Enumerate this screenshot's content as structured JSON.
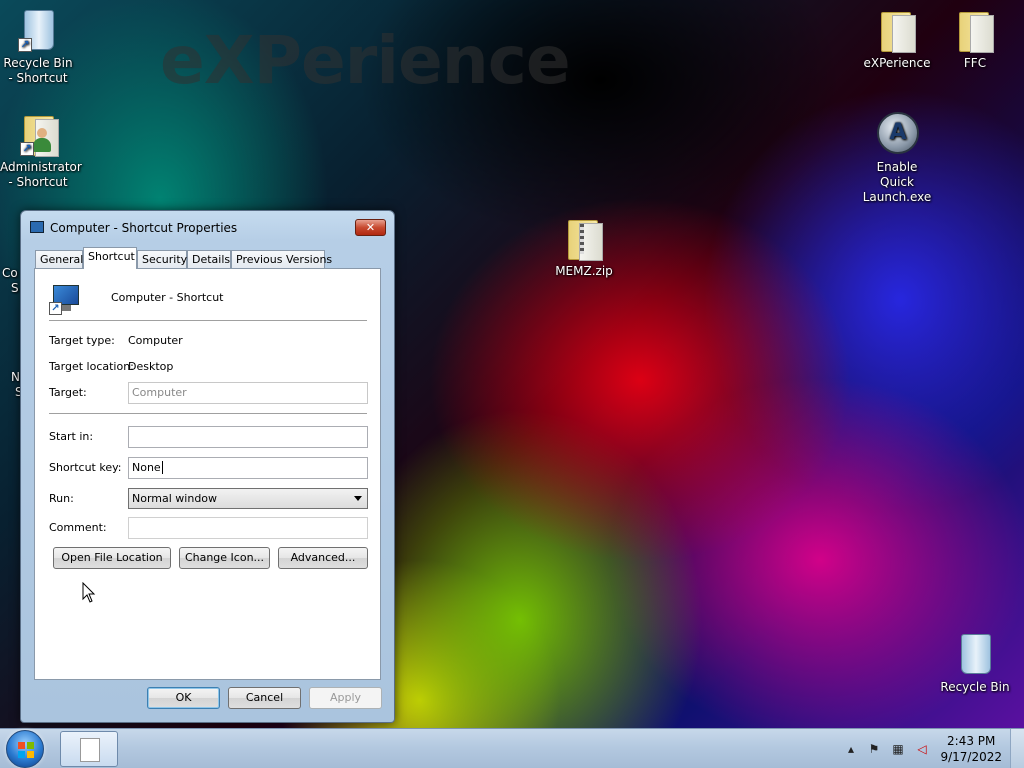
{
  "desktop": {
    "watermark": "eXPerience",
    "icons": [
      {
        "label": "Recycle Bin - Shortcut"
      },
      {
        "label": "Administrator - Shortcut"
      },
      {
        "label": "eXPerience"
      },
      {
        "label": "FFC"
      },
      {
        "label": "Enable Quick Launch.exe"
      },
      {
        "label": "MEMZ.zip"
      },
      {
        "label": "Recycle Bin"
      }
    ],
    "partial_labels": [
      "Co",
      "S",
      "N",
      "S"
    ]
  },
  "dialog": {
    "title": "Computer - Shortcut Properties",
    "close_glyph": "✕",
    "tabs": [
      "General",
      "Shortcut",
      "Security",
      "Details",
      "Previous Versions"
    ],
    "active_tab": "Shortcut",
    "shortcut_name": "Computer - Shortcut",
    "target_type_label": "Target type:",
    "target_type_value": "Computer",
    "target_location_label": "Target location:",
    "target_location_value": "Desktop",
    "target_label": "Target:",
    "target_value": "Computer",
    "start_in_label": "Start in:",
    "start_in_value": "",
    "shortcut_key_label": "Shortcut key:",
    "shortcut_key_value": "None",
    "run_label": "Run:",
    "run_value": "Normal window",
    "comment_label": "Comment:",
    "comment_value": "",
    "buttons": {
      "open_file_location": "Open File Location",
      "change_icon": "Change Icon...",
      "advanced": "Advanced...",
      "ok": "OK",
      "cancel": "Cancel",
      "apply": "Apply"
    }
  },
  "taskbar": {
    "clock_time": "2:43 PM",
    "clock_date": "9/17/2022",
    "tray_icons": [
      "chevron-up-icon",
      "flag-icon",
      "network-icon",
      "volume-muted-icon"
    ]
  },
  "colors": {
    "taskbar": "#b4c9e0",
    "dialog_frame": "#b6cee6",
    "close_button": "#c84a30"
  }
}
